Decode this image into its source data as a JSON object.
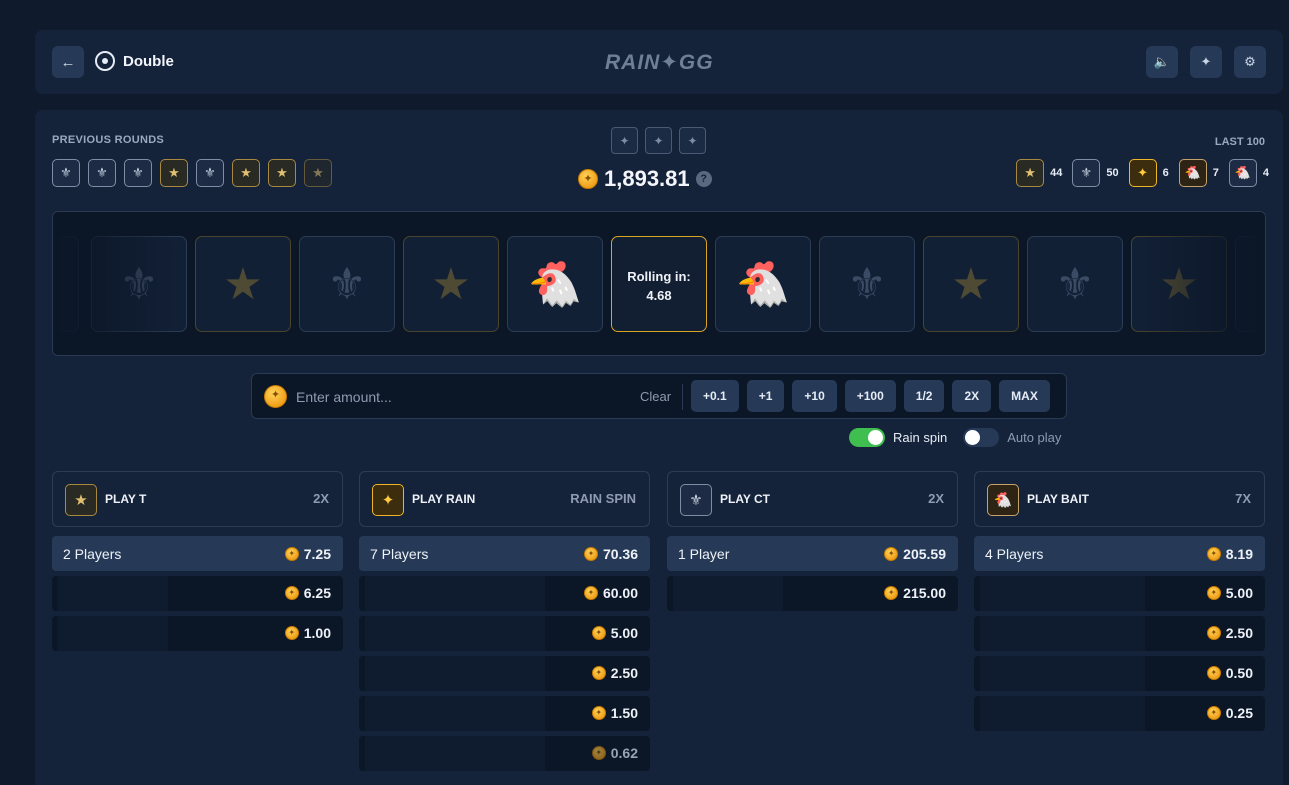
{
  "header": {
    "back_icon": "arrow-left-icon",
    "game_icon": "dice-icon",
    "game_title": "Double",
    "logo": "RAIN✦GG",
    "icons": [
      "volume-icon",
      "rain-star-icon",
      "gear-icon"
    ]
  },
  "previous_rounds": {
    "label": "PREVIOUS ROUNDS",
    "items": [
      "ct",
      "ct",
      "ct",
      "t",
      "ct",
      "t",
      "t",
      "t"
    ]
  },
  "balance": {
    "amount": "1,893.81",
    "help": "?"
  },
  "last100": {
    "label": "LAST 100",
    "stats": [
      {
        "type": "t",
        "count": "44"
      },
      {
        "type": "ct",
        "count": "50"
      },
      {
        "type": "rain",
        "count": "6"
      },
      {
        "type": "bait",
        "count": "7"
      },
      {
        "type": "ct",
        "count": "4"
      }
    ]
  },
  "roller": {
    "rolling_label": "Rolling in:",
    "countdown": "4.68"
  },
  "bet": {
    "placeholder": "Enter amount...",
    "clear": "Clear",
    "chips": [
      "+0.1",
      "+1",
      "+10",
      "+100",
      "1/2",
      "2X",
      "MAX"
    ]
  },
  "toggles": {
    "rain_spin": "Rain spin",
    "auto_play": "Auto play"
  },
  "columns": [
    {
      "name": "PLAY T",
      "mult": "2X",
      "players": "2 Players",
      "total": "7.25",
      "bets": [
        "6.25",
        "1.00"
      ]
    },
    {
      "name": "PLAY RAIN",
      "mult": "RAIN SPIN",
      "players": "7 Players",
      "total": "70.36",
      "bets": [
        "60.00",
        "5.00",
        "2.50",
        "1.50",
        "0.62"
      ]
    },
    {
      "name": "PLAY CT",
      "mult": "2X",
      "players": "1 Player",
      "total": "205.59",
      "bets": [
        "215.00"
      ]
    },
    {
      "name": "PLAY BAIT",
      "mult": "7X",
      "players": "4 Players",
      "total": "8.19",
      "bets": [
        "5.00",
        "2.50",
        "0.50",
        "0.25"
      ]
    }
  ],
  "colors": {
    "accent_gold": "#f0b429",
    "toggle_on": "#3fbf4f",
    "panel": "#15233a"
  }
}
